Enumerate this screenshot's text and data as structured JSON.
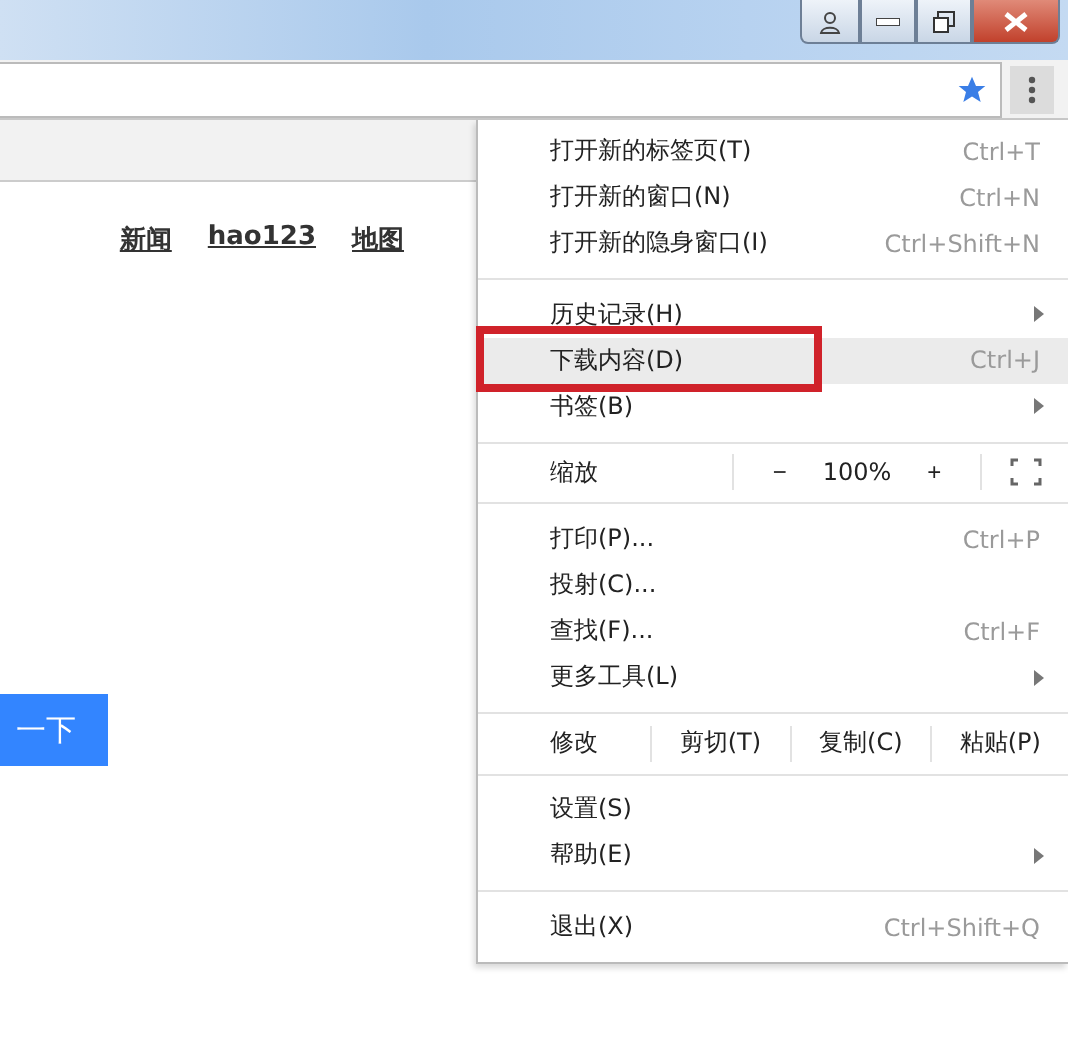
{
  "page": {
    "links": [
      {
        "label": "新闻"
      },
      {
        "label": "hao123"
      },
      {
        "label": "地图"
      }
    ],
    "search_button": {
      "label": "一下"
    }
  },
  "menu": {
    "items": [
      {
        "kind": "item",
        "label": "打开新的标签页(T)",
        "shortcut": "Ctrl+T",
        "submenu": false,
        "selected": false,
        "annotated": false
      },
      {
        "kind": "item",
        "label": "打开新的窗口(N)",
        "shortcut": "Ctrl+N",
        "submenu": false,
        "selected": false,
        "annotated": false
      },
      {
        "kind": "item",
        "label": "打开新的隐身窗口(I)",
        "shortcut": "Ctrl+Shift+N",
        "submenu": false,
        "selected": false,
        "annotated": false
      },
      {
        "kind": "separator"
      },
      {
        "kind": "item",
        "label": "历史记录(H)",
        "submenu": true,
        "selected": false,
        "annotated": false
      },
      {
        "kind": "item",
        "label": "下载内容(D)",
        "shortcut": "Ctrl+J",
        "submenu": false,
        "selected": true,
        "annotated": true
      },
      {
        "kind": "item",
        "label": "书签(B)",
        "submenu": true,
        "selected": false,
        "annotated": false
      },
      {
        "kind": "separator"
      },
      {
        "kind": "zoom",
        "label": "缩放",
        "minus": "−",
        "value": "100%",
        "plus": "+"
      },
      {
        "kind": "separator"
      },
      {
        "kind": "item",
        "label": "打印(P)...",
        "shortcut": "Ctrl+P",
        "submenu": false,
        "selected": false,
        "annotated": false
      },
      {
        "kind": "item",
        "label": "投射(C)...",
        "submenu": false,
        "selected": false,
        "annotated": false
      },
      {
        "kind": "item",
        "label": "查找(F)...",
        "shortcut": "Ctrl+F",
        "submenu": false,
        "selected": false,
        "annotated": false
      },
      {
        "kind": "item",
        "label": "更多工具(L)",
        "submenu": true,
        "selected": false,
        "annotated": false
      },
      {
        "kind": "separator"
      },
      {
        "kind": "edit",
        "label": "修改",
        "actions": [
          "剪切(T)",
          "复制(C)",
          "粘贴(P)"
        ]
      },
      {
        "kind": "separator"
      },
      {
        "kind": "item",
        "label": "设置(S)",
        "submenu": false,
        "selected": false,
        "annotated": false
      },
      {
        "kind": "item",
        "label": "帮助(E)",
        "submenu": true,
        "selected": false,
        "annotated": false
      },
      {
        "kind": "separator"
      },
      {
        "kind": "item",
        "label": "退出(X)",
        "shortcut": "Ctrl+Shift+Q",
        "submenu": false,
        "selected": false,
        "annotated": false
      }
    ]
  }
}
